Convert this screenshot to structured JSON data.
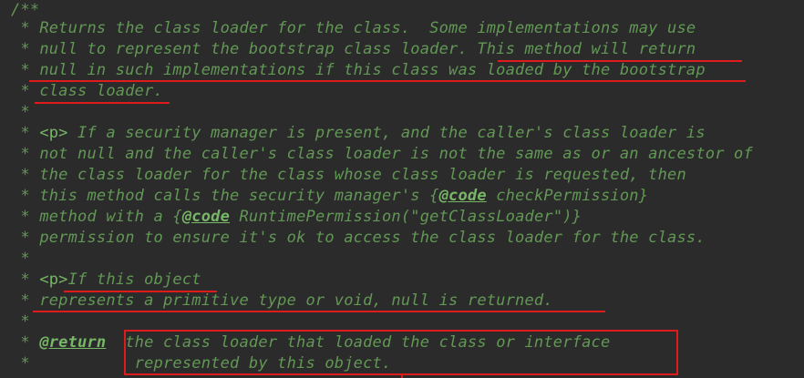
{
  "lines": [
    {
      "star": "/**",
      "text": ""
    },
    {
      "star": " * ",
      "text": "Returns the class loader for the class.  Some implementations may use"
    },
    {
      "star": " * ",
      "text": "null to represent the bootstrap class loader. This method will return"
    },
    {
      "star": " * ",
      "text": "null in such implementations if this class was loaded by the bootstrap"
    },
    {
      "star": " * ",
      "text": "class loader."
    },
    {
      "star": " *",
      "text": ""
    },
    {
      "star": " * ",
      "pre": "<p>",
      "text": " If a security manager is present, and the caller's class loader is"
    },
    {
      "star": " * ",
      "text": "not null and the caller's class loader is not the same as or an ancestor of"
    },
    {
      "star": " * ",
      "text": "the class loader for the class whose class loader is requested, then"
    },
    {
      "star": " * ",
      "text": "this method calls the security manager's {",
      "tag": "@code",
      "post": " checkPermission}"
    },
    {
      "star": " * ",
      "text": "method with a {",
      "tag": "@code",
      "post": " RuntimePermission(\"getClassLoader\")}"
    },
    {
      "star": " * ",
      "text": "permission to ensure it's ok to access the class loader for the class."
    },
    {
      "star": " *",
      "text": ""
    },
    {
      "star": " * ",
      "pre": "<p>",
      "text": "If this object"
    },
    {
      "star": " * ",
      "text": "represents a primitive type or void, null is returned."
    },
    {
      "star": " *",
      "text": ""
    },
    {
      "star": " * ",
      "tag": "@return",
      "text": "  the class loader that loaded the class or interface"
    },
    {
      "star": " * ",
      "text": "          represented by this object."
    }
  ]
}
